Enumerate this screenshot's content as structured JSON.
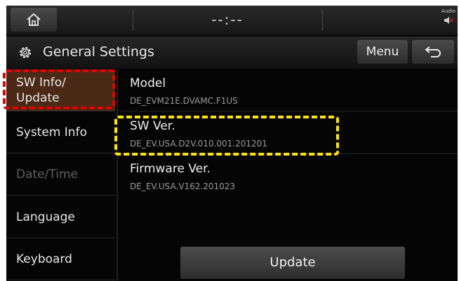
{
  "statusbar": {
    "clock": "--:--",
    "audio_label": "Audio"
  },
  "header": {
    "title": "General Settings",
    "menu_label": "Menu"
  },
  "sidebar": {
    "items": [
      {
        "label": "SW Info/\nUpdate",
        "state": "active"
      },
      {
        "label": "System Info",
        "state": "normal"
      },
      {
        "label": "Date/Time",
        "state": "disabled"
      },
      {
        "label": "Language",
        "state": "normal"
      },
      {
        "label": "Keyboard",
        "state": "normal"
      }
    ]
  },
  "info": {
    "rows": [
      {
        "title": "Model",
        "value": "DE_EVM21E.DVAMC.F1US"
      },
      {
        "title": "SW Ver.",
        "value": "DE_EV.USA.D2V.010.001.201201"
      },
      {
        "title": "Firmware Ver.",
        "value": "DE_EV.USA.V162.201023"
      }
    ]
  },
  "update_label": "Update",
  "colors": {
    "active_item_bg": "#4a2a16",
    "annotation_red": "#e60000",
    "annotation_yellow": "#ffe600"
  },
  "icons": [
    "home-icon",
    "audio-mute-icon",
    "gear-icon",
    "back-arrow-icon"
  ]
}
